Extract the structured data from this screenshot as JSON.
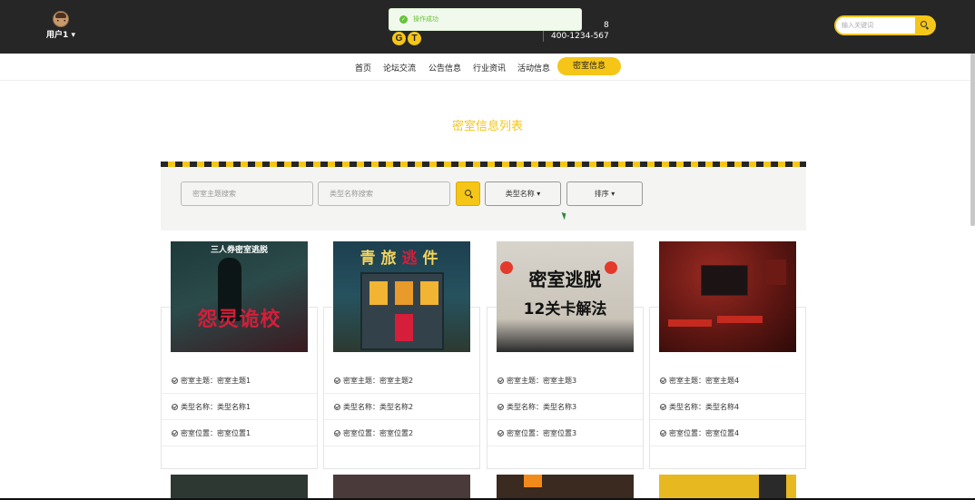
{
  "header": {
    "user_label": "用户1",
    "logo_letters": [
      "G",
      "T"
    ],
    "phone_top": "8",
    "phone": "400-1234-567",
    "toast": "操作成功",
    "search_placeholder": "输入关键词"
  },
  "nav": {
    "items": [
      "首页",
      "论坛交流",
      "公告信息",
      "行业资讯",
      "活动信息"
    ],
    "active": "密室信息"
  },
  "page_title": "密室信息列表",
  "filter": {
    "theme_placeholder": "密室主题搜索",
    "type_placeholder": "类型名称搜索",
    "type_dropdown": "类型名称 ▾",
    "sort_dropdown": "排序 ▾"
  },
  "cards": [
    {
      "image_text_top": "三人券密室逃脱",
      "image_text_main": "怨灵诡校",
      "theme": "密室主题：密室主题1",
      "type": "类型名称：类型名称1",
      "location": "密室位置：密室位置1"
    },
    {
      "image_text_top": "青旅",
      "image_text_accent": "逃",
      "image_text_end": "件",
      "theme": "密室主题：密室主题2",
      "type": "类型名称：类型名称2",
      "location": "密室位置：密室位置2"
    },
    {
      "image_text_top": "密室逃脱",
      "image_text_main": "12关卡解法",
      "theme": "密室主题：密室主题3",
      "type": "类型名称：类型名称3",
      "location": "密室位置：密室位置3"
    },
    {
      "theme": "密室主题：密室主题4",
      "type": "类型名称：类型名称4",
      "location": "密室位置：密室位置4"
    }
  ],
  "colors": {
    "accent": "#f5c518",
    "topbar": "#262626",
    "toast_bg": "#f0f9eb",
    "toast_text": "#67c23a"
  }
}
